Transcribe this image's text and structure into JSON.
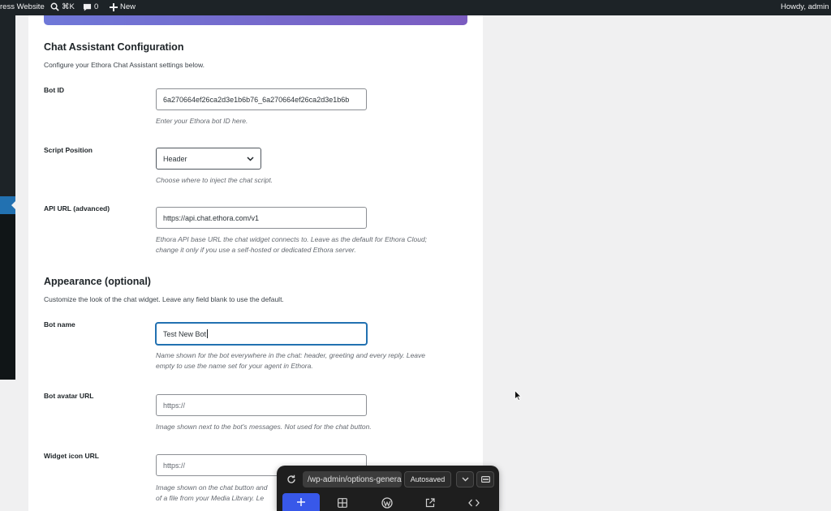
{
  "admin_bar": {
    "site_name": "ress Website",
    "search_shortcut": "⌘K",
    "comments_count": "0",
    "new_label": "New",
    "howdy": "Howdy, admin"
  },
  "settings": {
    "chat_section": {
      "title": "Chat Assistant Configuration",
      "intro": "Configure your Ethora Chat Assistant settings below."
    },
    "bot_id": {
      "label": "Bot ID",
      "value": "6a270664ef26ca2d3e1b6b76_6a270664ef26ca2d3e1b6b",
      "description": "Enter your Ethora bot ID here."
    },
    "script_position": {
      "label": "Script Position",
      "value": "Header",
      "description": "Choose where to inject the chat script."
    },
    "api_url": {
      "label": "API URL (advanced)",
      "value": "https://api.chat.ethora.com/v1",
      "description_line1": "Ethora API base URL the chat widget connects to. Leave as the default for Ethora Cloud;",
      "description_line2": "change it only if you use a self-hosted or dedicated Ethora server."
    },
    "appearance_section": {
      "title": "Appearance (optional)",
      "intro": "Customize the look of the chat widget. Leave any field blank to use the default."
    },
    "bot_name": {
      "label": "Bot name",
      "value": "Test New Bot",
      "description_line1": "Name shown for the bot everywhere in the chat: header, greeting and every reply. Leave",
      "description_line2": "empty to use the name set for your agent in Ethora."
    },
    "bot_avatar_url": {
      "label": "Bot avatar URL",
      "placeholder": "https://",
      "description": "Image shown next to the bot's messages. Not used for the chat button."
    },
    "widget_icon_url": {
      "label": "Widget icon URL",
      "placeholder": "https://",
      "description_line1": "Image shown on the chat button and",
      "description_line2": "of a file from your Media Library. Le"
    }
  },
  "floating_toolbar": {
    "url": "/wp-admin/options-general",
    "autosaved": "Autosaved"
  },
  "colors": {
    "admin_bar": "#1d2327",
    "primary": "#2271b1",
    "toolbar_accent": "#3858e9"
  }
}
